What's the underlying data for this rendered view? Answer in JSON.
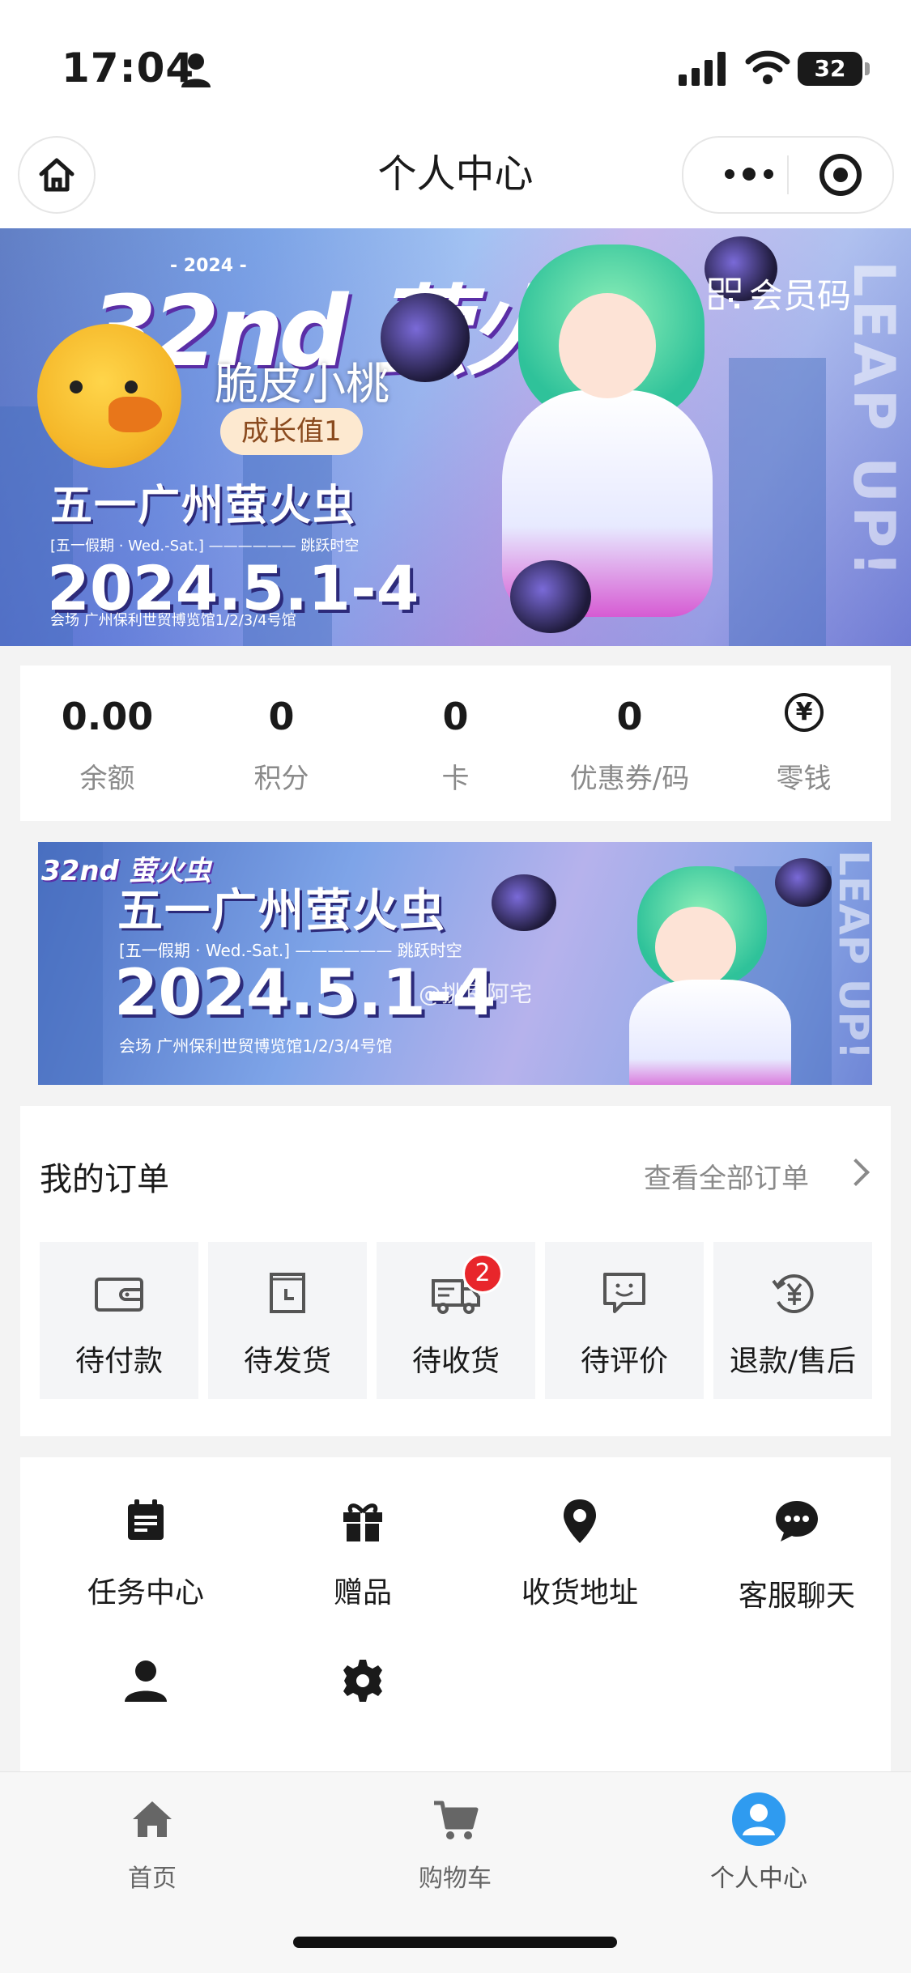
{
  "status_bar": {
    "time": "17:04",
    "battery": "32"
  },
  "nav": {
    "title": "个人中心"
  },
  "profile": {
    "username": "脆皮小桃",
    "growth": "成长值1",
    "member_code": "会员码"
  },
  "hero_banner": {
    "logo": "32nd 萤火虫",
    "year": "- 2024 -",
    "event": "五一广州萤火虫",
    "subtitle": "[五一假期 · Wed.-Sat.] —————— 跳跃时空",
    "date": "2024.5.1-4",
    "venue": "会场 广州保利世贸博览馆1/2/3/4号馆",
    "side_text": "LEAP UP!"
  },
  "stats": [
    {
      "value": "0.00",
      "label": "余额"
    },
    {
      "value": "0",
      "label": "积分"
    },
    {
      "value": "0",
      "label": "卡"
    },
    {
      "value": "0",
      "label": "优惠券/码"
    },
    {
      "value": "",
      "label": "零钱",
      "icon": "yen-circle-icon"
    }
  ],
  "banner2": {
    "logo": "32nd 萤火虫",
    "event": "五一广州萤火虫",
    "subtitle": "[五一假期 · Wed.-Sat.] —————— 跳跃时空",
    "date": "2024.5.1-4",
    "venue": "会场 广州保利世贸博览馆1/2/3/4号馆",
    "watermark": "@挑良阿宅",
    "side_text": "LEAP UP!"
  },
  "orders": {
    "title": "我的订单",
    "view_all": "查看全部订单",
    "items": [
      {
        "label": "待付款",
        "icon": "wallet-icon"
      },
      {
        "label": "待发货",
        "icon": "box-clock-icon"
      },
      {
        "label": "待收货",
        "icon": "truck-icon",
        "badge": "2"
      },
      {
        "label": "待评价",
        "icon": "review-icon"
      },
      {
        "label": "退款/售后",
        "icon": "refund-icon"
      }
    ]
  },
  "services": [
    {
      "label": "任务中心",
      "icon": "task-icon"
    },
    {
      "label": "赠品",
      "icon": "gift-icon"
    },
    {
      "label": "收货地址",
      "icon": "location-pin-icon"
    },
    {
      "label": "客服聊天",
      "icon": "chat-icon"
    },
    {
      "label": "",
      "icon": "person-icon"
    },
    {
      "label": "",
      "icon": "settings-gear-icon"
    }
  ],
  "tabbar": [
    {
      "label": "首页",
      "icon": "home-icon"
    },
    {
      "label": "购物车",
      "icon": "cart-icon"
    },
    {
      "label": "个人中心",
      "icon": "user-circle-icon",
      "active": true
    }
  ],
  "colors": {
    "accent": "#2f9bf0",
    "badge": "#e8262b",
    "growth_bg": "#fde9d0"
  }
}
